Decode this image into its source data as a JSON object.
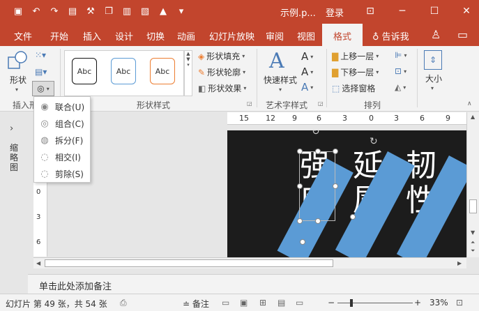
{
  "titlebar": {
    "doc_title": "示例.p...",
    "login": "登录",
    "qat_icons": [
      "save-icon",
      "undo-icon",
      "redo-icon",
      "start-icon",
      "hammer-icon",
      "copy-icon",
      "shapes-icon",
      "paste-icon",
      "more-icon",
      "customize-icon"
    ],
    "colors": {
      "bg": "#c2452d"
    }
  },
  "tabs": [
    {
      "label": "文件"
    },
    {
      "label": "开始"
    },
    {
      "label": "插入"
    },
    {
      "label": "设计"
    },
    {
      "label": "切换"
    },
    {
      "label": "动画"
    },
    {
      "label": "幻灯片放映"
    },
    {
      "label": "审阅"
    },
    {
      "label": "视图"
    },
    {
      "label": "格式",
      "active": true
    }
  ],
  "tellme": "告诉我",
  "ribbon": {
    "insert_shapes": {
      "shape_label": "形状",
      "group_label": "插入形"
    },
    "shape_styles": {
      "group_label": "形状样式",
      "gallery": [
        "Abc",
        "Abc",
        "Abc"
      ],
      "fill": "形状填充",
      "outline": "形状轮廓",
      "effects": "形状效果"
    },
    "wordart": {
      "group_label": "艺术字样式",
      "quick_styles": "快速样式"
    },
    "arrange": {
      "group_label": "排列",
      "bring_forward": "上移一层",
      "send_backward": "下移一层",
      "selection_pane": "选择窗格"
    },
    "size": {
      "label": "大小"
    }
  },
  "merge_menu": {
    "items": [
      {
        "label": "联合(U)"
      },
      {
        "label": "组合(C)"
      },
      {
        "label": "拆分(F)"
      },
      {
        "label": "相交(I)"
      },
      {
        "label": "剪除(S)"
      }
    ]
  },
  "left_pane": {
    "label": "缩略图"
  },
  "rulers": {
    "h": [
      "15",
      "12",
      "9",
      "6",
      "3",
      "0",
      "3",
      "6",
      "9"
    ],
    "v": [
      "0",
      "3",
      "6"
    ]
  },
  "slide": {
    "text_col1": [
      "强",
      "度"
    ],
    "text_col2": [
      "延",
      "属"
    ],
    "text_col3": [
      "韧",
      "性"
    ],
    "colors": {
      "bg": "#1c1c1c",
      "band": "#5b9bd5"
    }
  },
  "notes": {
    "placeholder": "单击此处添加备注"
  },
  "statusbar": {
    "slide_info": "幻灯片 第 49 张，共 54 张",
    "notes": "备注",
    "zoom": "33%"
  }
}
